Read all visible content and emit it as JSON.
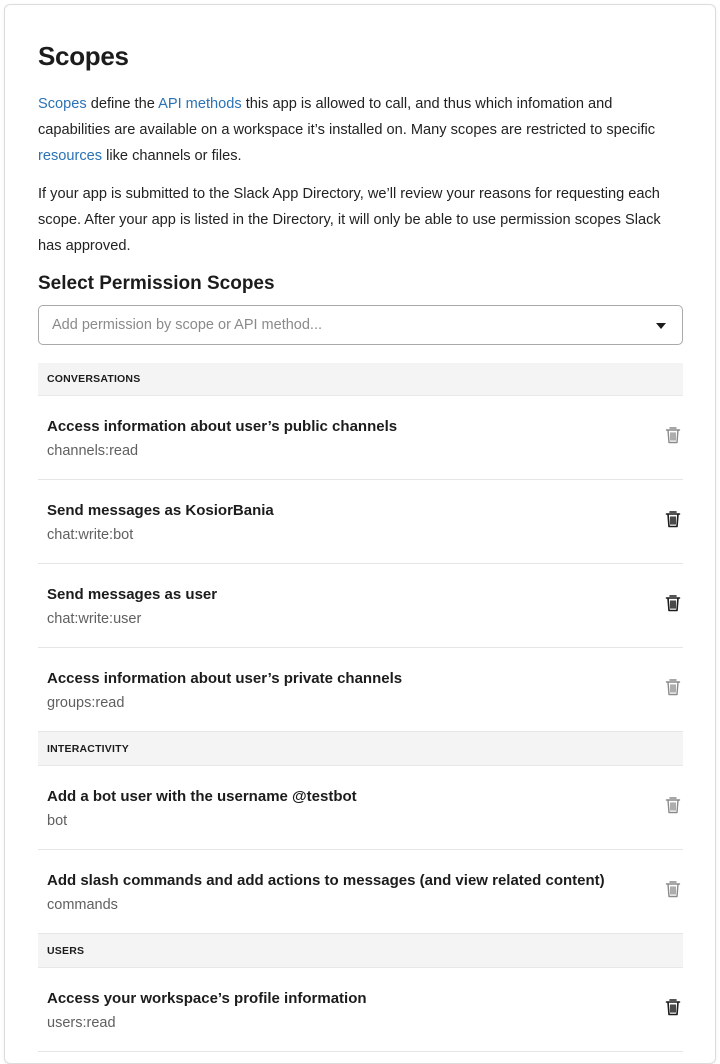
{
  "header": {
    "title": "Scopes",
    "intro": {
      "link_scopes": "Scopes",
      "text_1": " define the ",
      "link_api_methods": "API methods",
      "text_2": " this app is allowed to call, and thus which infomation and capabilities are available on a workspace it’s installed on. Many scopes are restricted to specific ",
      "link_resources": "resources",
      "text_3": " like channels or files."
    },
    "review_note": "If your app is submitted to the Slack App Directory, we’ll review your reasons for requesting each scope. After your app is listed in the Directory, it will only be able to use permission scopes Slack has approved."
  },
  "permissions": {
    "title": "Select Permission Scopes",
    "search_placeholder": "Add permission by scope or API method..."
  },
  "sections": [
    {
      "name": "CONVERSATIONS",
      "items": [
        {
          "label": "Access information about user’s public channels",
          "scope": "channels:read"
        },
        {
          "label": "Send messages as KosiorBania",
          "scope": "chat:write:bot"
        },
        {
          "label": "Send messages as user",
          "scope": "chat:write:user"
        },
        {
          "label": "Access information about user’s private channels",
          "scope": "groups:read"
        }
      ]
    },
    {
      "name": "INTERACTIVITY",
      "items": [
        {
          "label": "Add a bot user with the username @testbot",
          "scope": "bot"
        },
        {
          "label": "Add slash commands and add actions to messages (and view related content)",
          "scope": "commands"
        }
      ]
    },
    {
      "name": "USERS",
      "items": [
        {
          "label": "Access your workspace’s profile information",
          "scope": "users:read"
        }
      ]
    }
  ],
  "colors": {
    "link": "#2a72b5",
    "section_header_bg": "#f4f4f4",
    "muted_text": "#616061"
  },
  "icons": {
    "remove": "trash-icon",
    "dropdown": "caret-down-icon"
  }
}
